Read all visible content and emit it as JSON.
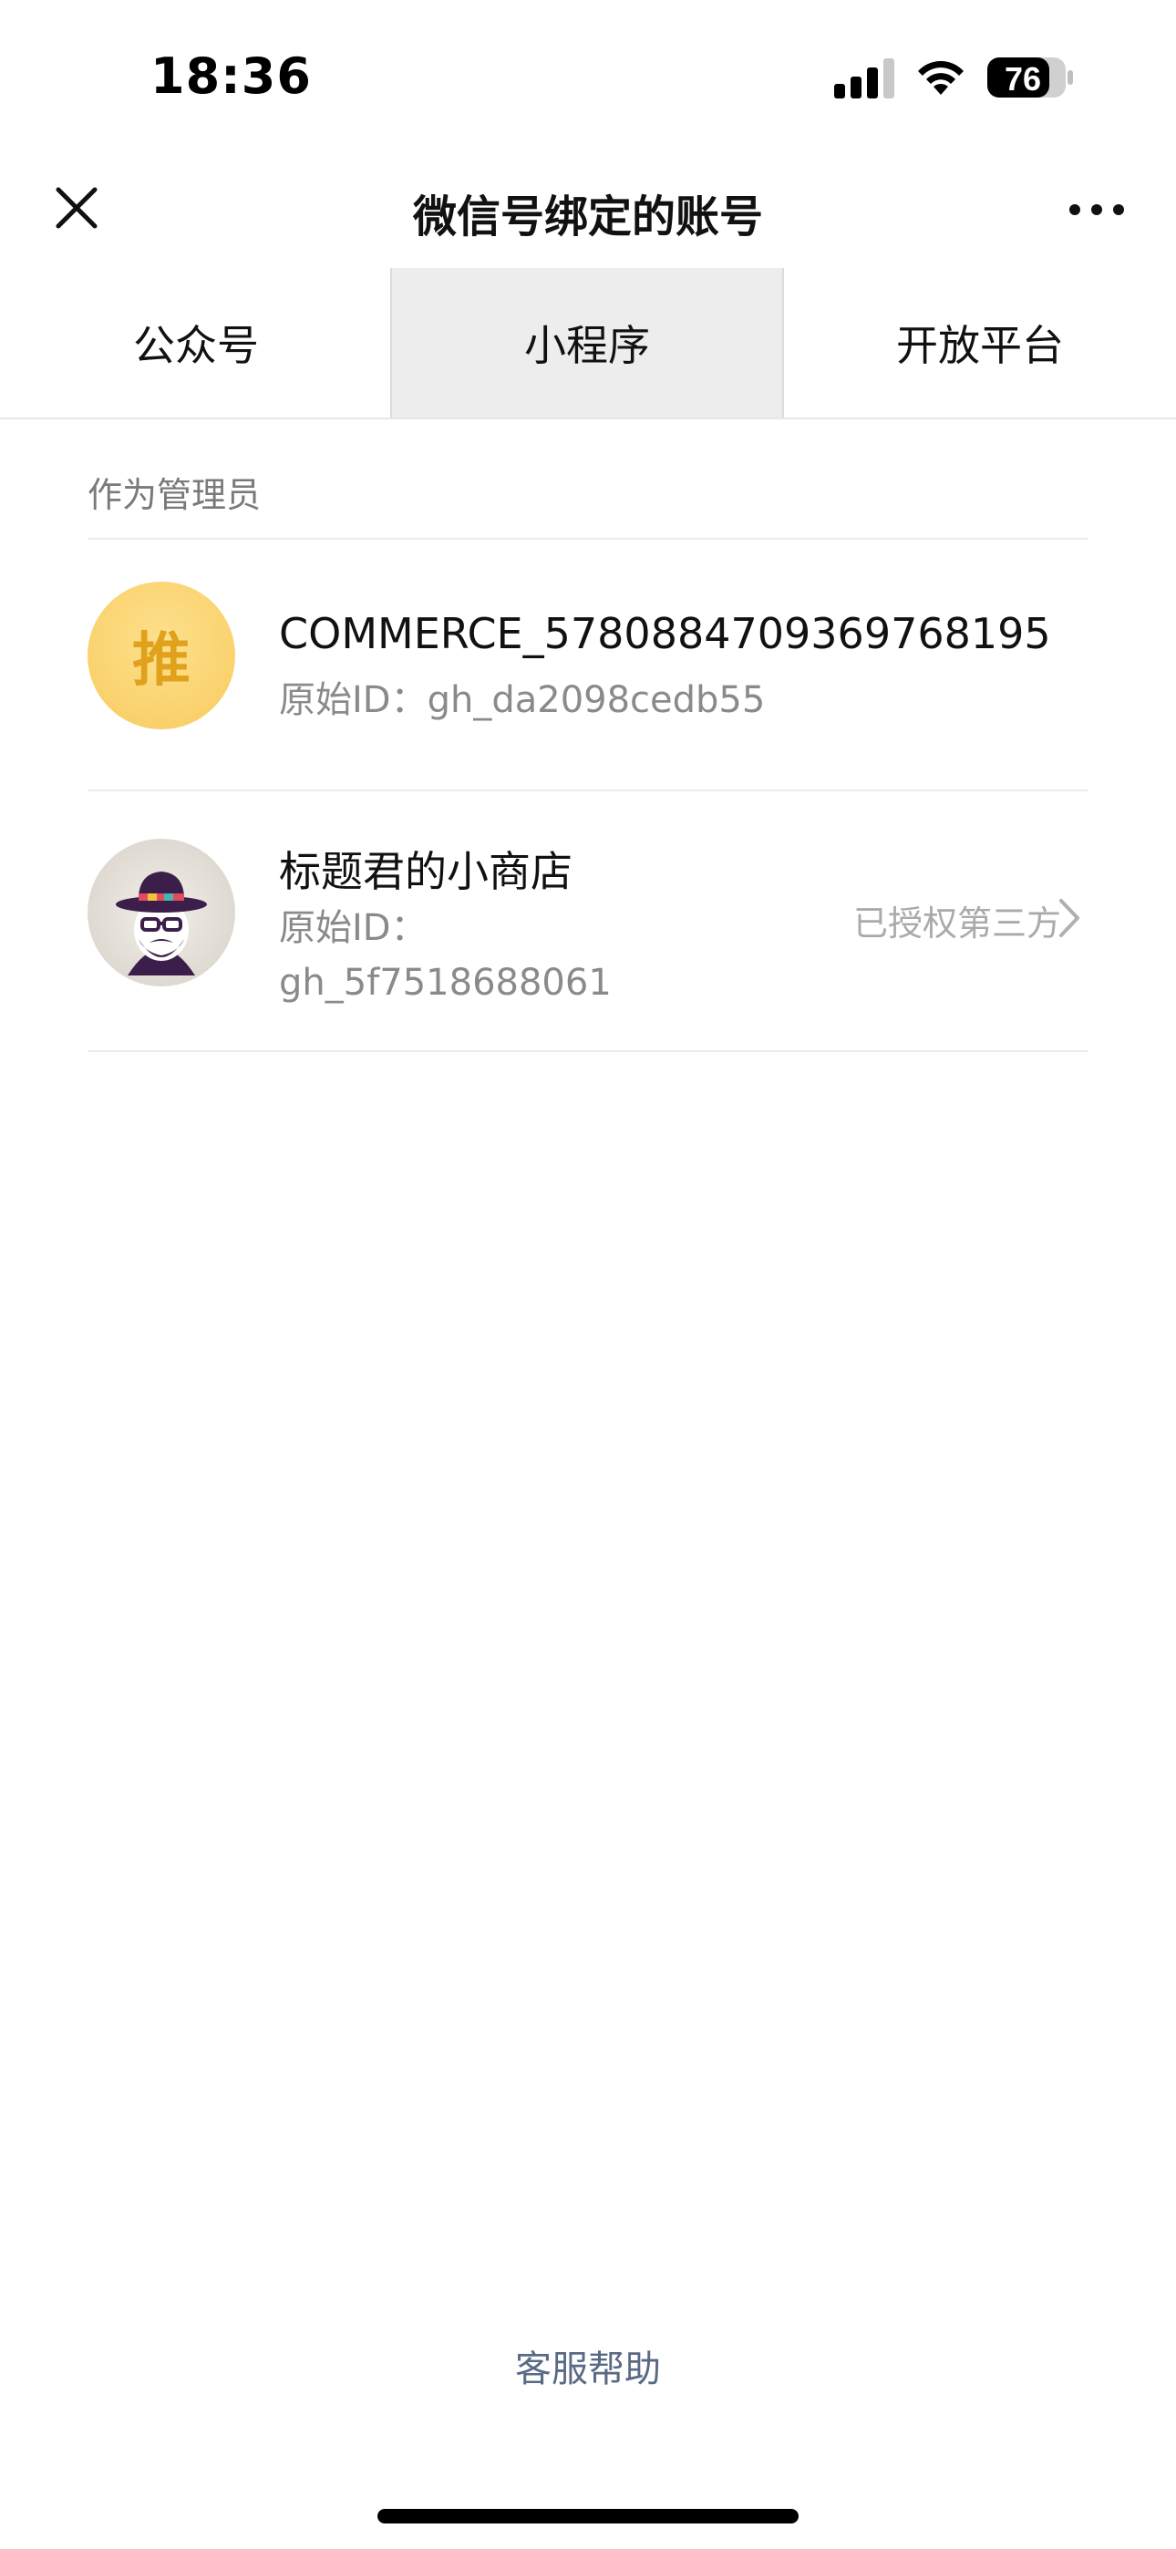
{
  "status_bar": {
    "time": "18:36",
    "battery": "76",
    "icons": [
      "signal-icon",
      "wifi-icon",
      "battery-icon"
    ]
  },
  "nav": {
    "title": "微信号绑定的账号",
    "close_icon": "close-icon",
    "more_icon": "more-icon"
  },
  "tabs": [
    {
      "label": "公众号",
      "selected": false
    },
    {
      "label": "小程序",
      "selected": true
    },
    {
      "label": "开放平台",
      "selected": false
    }
  ],
  "section": {
    "label": "作为管理员"
  },
  "items": [
    {
      "avatar_text": "推",
      "name": "COMMERCE_5780884709369768195",
      "sub_line1": "原始ID：gh_da2098cedb55",
      "sub_line2": "",
      "right_text": ""
    },
    {
      "avatar_text": "",
      "name": "标题君的小商店",
      "sub_line1": "原始ID：",
      "sub_line2": "gh_5f7518688061",
      "right_text": "已授权第三方"
    }
  ],
  "footer": {
    "help_label": "客服帮助"
  },
  "colors": {
    "selected_tab_bg": "#ededed",
    "link": "#5a6a85",
    "avatar_yellow": "#fbd472"
  }
}
